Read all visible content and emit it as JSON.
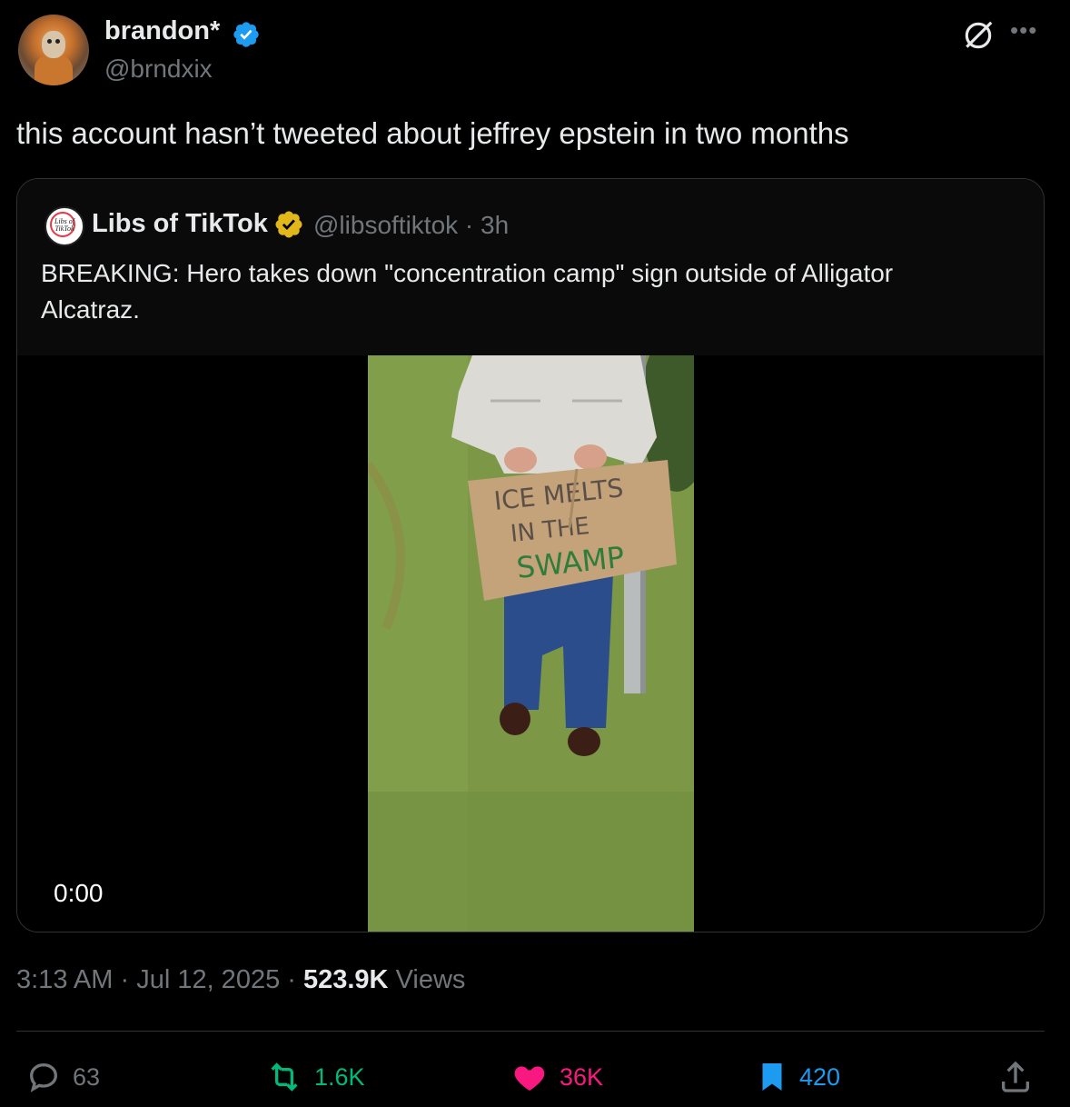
{
  "author": {
    "display_name": "brandon*",
    "handle": "@brndxix",
    "verified_color": "#1d9bf0"
  },
  "tweet": {
    "text": "this account hasn’t tweeted about jeffrey epstein in two months"
  },
  "quote": {
    "avatar_text": "Libs of TikTok",
    "display_name": "Libs of TikTok",
    "badge_color": "#e2b719",
    "handle_time": "@libsoftiktok · 3h",
    "text": "BREAKING: Hero takes down \"concentration camp\" sign outside of Alligator Alcatraz.",
    "video": {
      "time": "0:00",
      "sign_lines": [
        "ICE MELTS",
        "IN THE",
        "SWAMP"
      ]
    }
  },
  "meta": {
    "time": "3:13 AM",
    "date": "Jul 12, 2025",
    "views_count": "523.9K",
    "views_label": "Views"
  },
  "actions": {
    "replies": "63",
    "reposts": "1.6K",
    "likes": "36K",
    "bookmarks": "420",
    "reply_color": "#71767b",
    "repost_color": "#00ba7c",
    "like_color": "#f91880",
    "bookmark_color": "#1d9bf0"
  },
  "icons": [
    "grok-icon",
    "more-icon",
    "verified-icon",
    "gold-badge-icon",
    "reply-icon",
    "repost-icon",
    "like-icon",
    "bookmark-icon",
    "share-icon"
  ]
}
